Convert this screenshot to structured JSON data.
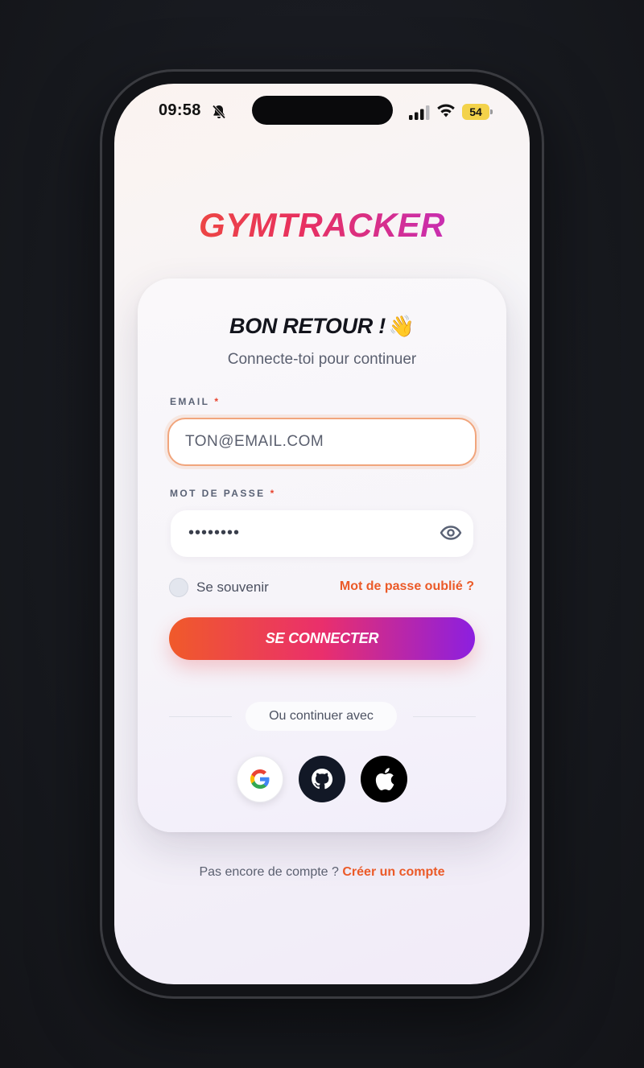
{
  "status_bar": {
    "time": "09:58",
    "battery": "54",
    "icons": [
      "bell-slash-icon",
      "signal-icon",
      "wifi-icon",
      "battery-icon"
    ]
  },
  "app": {
    "brand": "GYMTRACKER"
  },
  "login": {
    "title": "BON RETOUR !",
    "title_emoji": "👋",
    "subtitle": "Connecte-toi pour continuer",
    "email_label": "EMAIL",
    "email_placeholder": "TON@EMAIL.COM",
    "required_mark": "*",
    "password_label": "MOT DE PASSE",
    "password_value": "••••••••",
    "remember_label": "Se souvenir",
    "forgot_link": "Mot de passe oublié ?",
    "submit_label": "SE CONNECTER",
    "divider_text": "Ou continuer avec",
    "social_providers": [
      "google-icon",
      "github-icon",
      "apple-icon"
    ],
    "signup_prompt": "Pas encore de compte ?",
    "signup_link": "Créer un compte"
  },
  "colors": {
    "accent_orange": "#eb5a28",
    "accent_pink": "#ea2f6c",
    "accent_purple": "#8c1fe0",
    "title_dark": "#13141c"
  }
}
